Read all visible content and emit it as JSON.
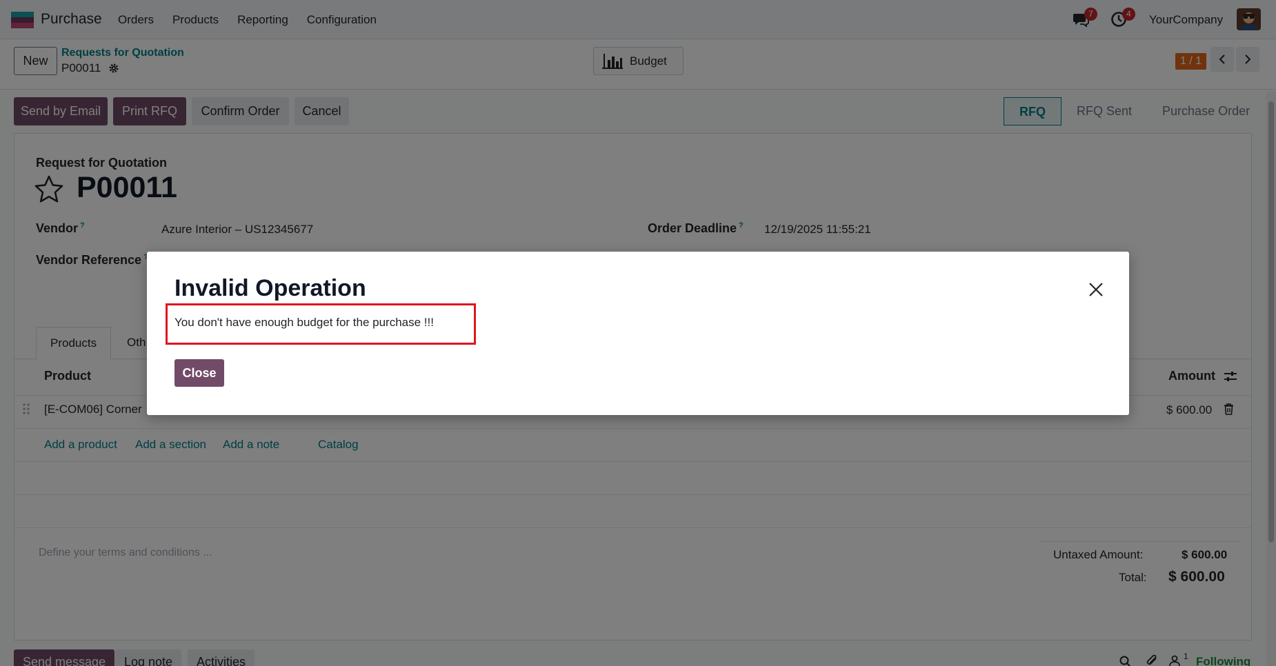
{
  "navbar": {
    "app_name": "Purchase",
    "menu": [
      "Orders",
      "Products",
      "Reporting",
      "Configuration"
    ],
    "messages_count": "7",
    "activities_count": "4",
    "company": "YourCompany"
  },
  "control_panel": {
    "new_label": "New",
    "breadcrumb_parent": "Requests for Quotation",
    "breadcrumb_current": "P00011",
    "budget_label": "Budget",
    "pager": "1 / 1"
  },
  "actions": {
    "send_email": "Send by Email",
    "print_rfq": "Print RFQ",
    "confirm_order": "Confirm Order",
    "cancel": "Cancel"
  },
  "statusbar": {
    "steps": [
      "RFQ",
      "RFQ Sent",
      "Purchase Order"
    ],
    "active": "RFQ"
  },
  "form": {
    "doc_type": "Request for Quotation",
    "name": "P00011",
    "vendor_label": "Vendor",
    "vendor_value": "Azure Interior – US12345677",
    "vendor_ref_label": "Vendor Reference",
    "deadline_label": "Order Deadline",
    "deadline_value": "12/19/2025 11:55:21",
    "help_mark": "?",
    "tabs": [
      "Products",
      "Oth"
    ],
    "columns": {
      "product": "Product",
      "amount": "Amount"
    },
    "line": {
      "product": "[E-COM06] Corner",
      "amount": "$ 600.00"
    },
    "add_links": [
      "Add a product",
      "Add a section",
      "Add a note",
      "Catalog"
    ],
    "terms_placeholder": "Define your terms and conditions ...",
    "untaxed_label": "Untaxed Amount:",
    "untaxed_value": "$ 600.00",
    "total_label": "Total:",
    "total_value": "$ 600.00"
  },
  "chatter": {
    "send_message": "Send message",
    "log_note": "Log note",
    "activities": "Activities",
    "followers_count": "1",
    "following": "Following"
  },
  "dialog": {
    "title": "Invalid Operation",
    "message": "You don't have enough budget for the purchase !!!",
    "close_label": "Close"
  },
  "colors": {
    "brand": "#714b67",
    "link": "#017e84",
    "highlight_border": "#e0141e",
    "pager_bg": "#e0671b"
  }
}
